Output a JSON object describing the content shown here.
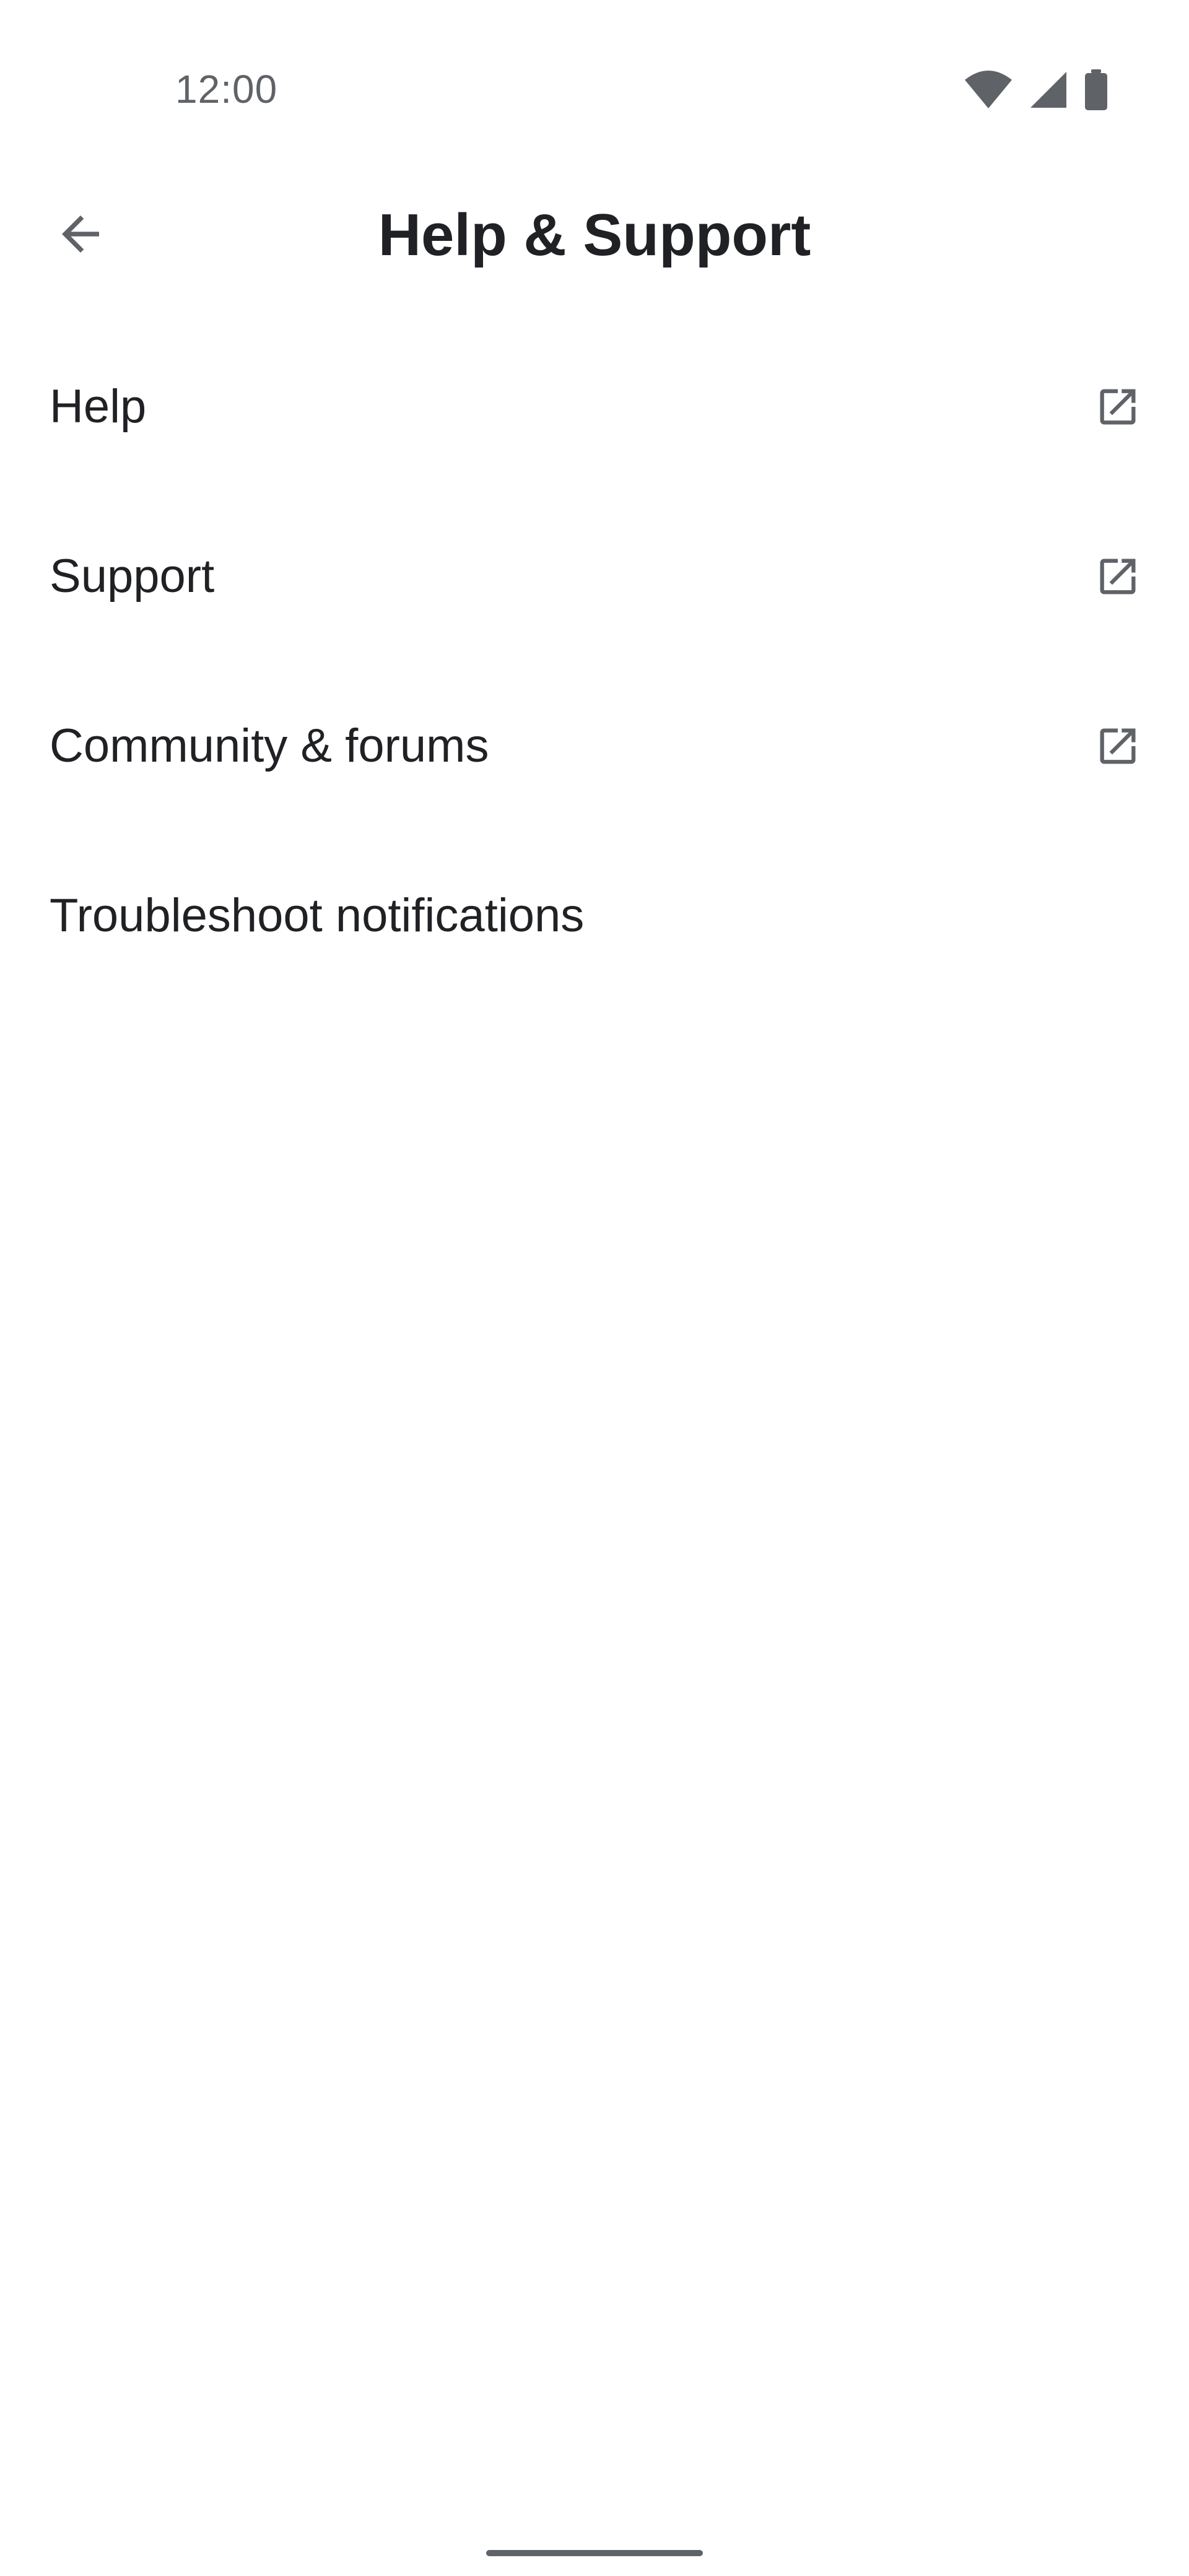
{
  "status_bar": {
    "time": "12:00",
    "icons": [
      "wifi-icon",
      "signal-icon",
      "battery-icon"
    ]
  },
  "app_bar": {
    "back_icon": "arrow-back-icon",
    "title": "Help & Support"
  },
  "menu": {
    "items": [
      {
        "label": "Help",
        "icon": "open-in-new-icon"
      },
      {
        "label": "Support",
        "icon": "open-in-new-icon"
      },
      {
        "label": "Community & forums",
        "icon": "open-in-new-icon"
      },
      {
        "label": "Troubleshoot notifications",
        "icon": ""
      }
    ]
  },
  "colors": {
    "background": "#ffffff",
    "text_primary": "#202124",
    "text_secondary": "#5f6368",
    "icon": "#5f6368"
  }
}
